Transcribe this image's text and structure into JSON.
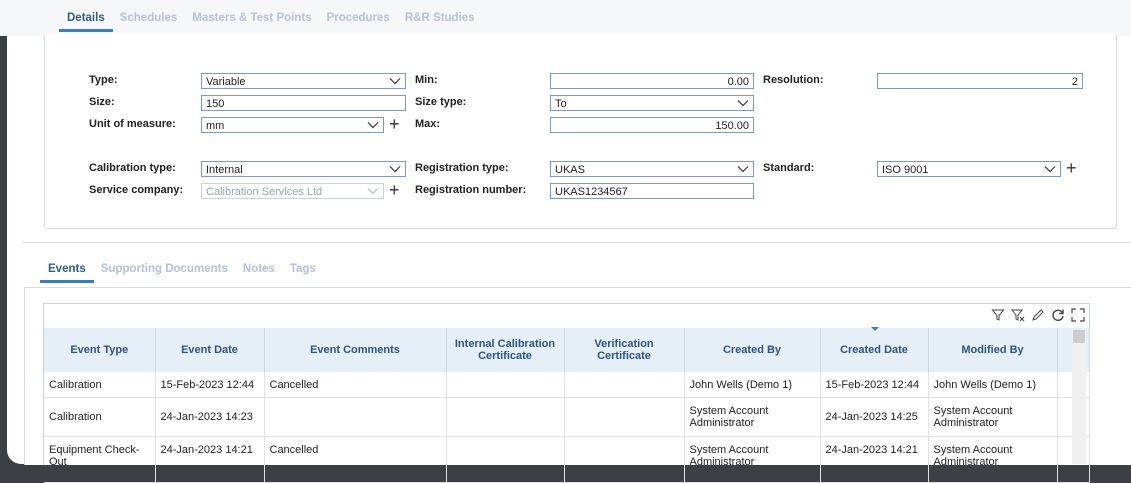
{
  "top_tabs": [
    "Details",
    "Schedules",
    "Masters & Test Points",
    "Procedures",
    "R&R Studies"
  ],
  "form": {
    "type_label": "Type:",
    "type_value": "Variable",
    "size_label": "Size:",
    "size_value": "150",
    "uom_label": "Unit of measure:",
    "uom_value": "mm",
    "min_label": "Min:",
    "min_value": "0.00",
    "size_type_label": "Size type:",
    "size_type_value": "To",
    "max_label": "Max:",
    "max_value": "150.00",
    "resolution_label": "Resolution:",
    "resolution_value": "2",
    "cal_type_label": "Calibration type:",
    "cal_type_value": "Internal",
    "service_label": "Service company:",
    "service_value": "Calibration Services Ltd",
    "reg_type_label": "Registration type:",
    "reg_type_value": "UKAS",
    "reg_num_label": "Registration number:",
    "reg_num_value": "UKAS1234567",
    "standard_label": "Standard:",
    "standard_value": "ISO 9001"
  },
  "bottom_tabs": [
    "Events",
    "Supporting Documents",
    "Notes",
    "Tags"
  ],
  "grid": {
    "columns": [
      "Event Type",
      "Event Date",
      "Event Comments",
      "Internal Calibration Certificate",
      "Verification Certificate",
      "Created By",
      "Created Date",
      "Modified By"
    ],
    "rows": [
      [
        "Calibration",
        "15-Feb-2023 12:44",
        "Cancelled",
        "",
        "",
        "John Wells (Demo 1)",
        "15-Feb-2023 12:44",
        "John Wells (Demo 1)"
      ],
      [
        "Calibration",
        "24-Jan-2023 14:23",
        "",
        "",
        "",
        "System Account Administrator",
        "24-Jan-2023 14:25",
        "System Account Administrator"
      ],
      [
        "Equipment Check-Out",
        "24-Jan-2023 14:21",
        "Cancelled",
        "",
        "",
        "System Account Administrator",
        "24-Jan-2023 14:21",
        "System Account Administrator"
      ]
    ],
    "toolbar_icons": [
      "filter-icon",
      "clear-filter-icon",
      "edit-icon",
      "refresh-icon",
      "expand-icon"
    ]
  },
  "colors": {
    "accent": "#3a7bc8",
    "header_bg": "#e6eef7",
    "background": "#3c3f44"
  }
}
